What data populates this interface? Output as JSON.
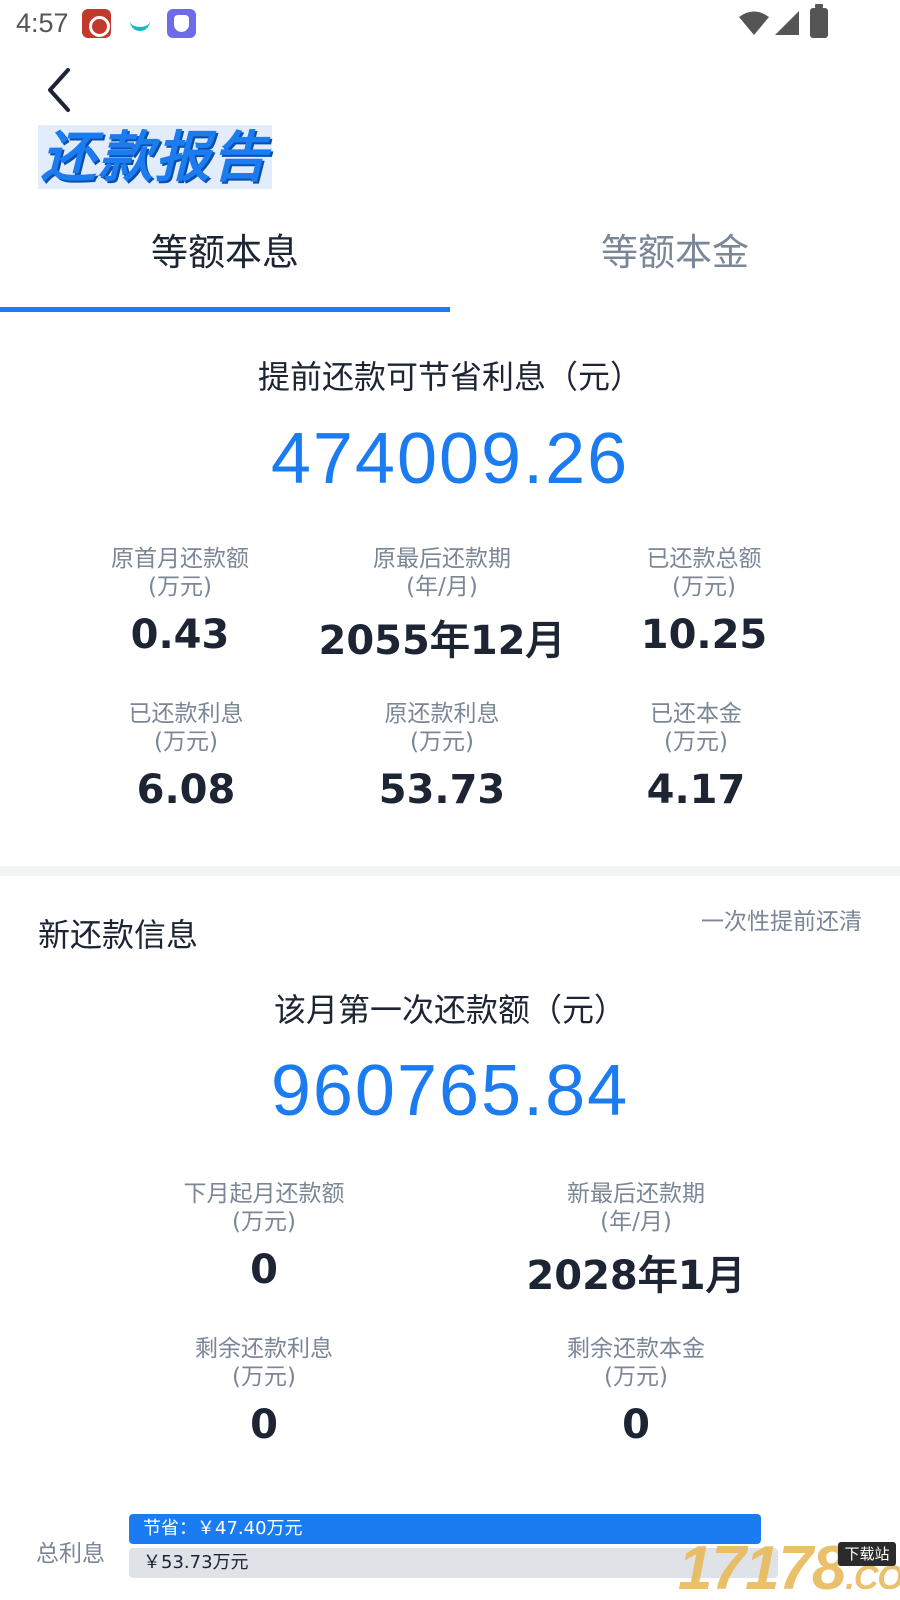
{
  "status": {
    "time": "4:57",
    "icons": [
      "weibo-app-icon",
      "teal-app-icon",
      "purple-app-icon",
      "wifi-icon",
      "signal-icon",
      "battery-icon"
    ]
  },
  "header": {
    "back_icon": "chevron-left-icon",
    "title": "还款报告"
  },
  "tabs": [
    {
      "label": "等额本息",
      "active": true
    },
    {
      "label": "等额本金",
      "active": false
    }
  ],
  "savings": {
    "title": "提前还款可节省利息（元）",
    "value": "474009.26"
  },
  "original_stats": [
    {
      "label": "原首月还款额",
      "unit": "(万元)",
      "value": "0.43"
    },
    {
      "label": "原最后还款期",
      "unit": "(年/月)",
      "value": "2055年12月"
    },
    {
      "label": "已还款总额",
      "unit": "(万元)",
      "value": "10.25"
    },
    {
      "label": "已还款利息",
      "unit": "(万元)",
      "value": "6.08"
    },
    {
      "label": "原还款利息",
      "unit": "(万元)",
      "value": "53.73"
    },
    {
      "label": "已还本金",
      "unit": "(万元)",
      "value": "4.17"
    }
  ],
  "new_info": {
    "section_title": "新还款信息",
    "mode_link": "一次性提前还清",
    "first_payment_title": "该月第一次还款额（元）",
    "first_payment_value": "960765.84",
    "stats": [
      {
        "label": "下月起月还款额",
        "unit": "(万元)",
        "value": "0"
      },
      {
        "label": "新最后还款期",
        "unit": "(年/月)",
        "value": "2028年1月"
      },
      {
        "label": "剩余还款利息",
        "unit": "(万元)",
        "value": "0"
      },
      {
        "label": "剩余还款本金",
        "unit": "(万元)",
        "value": "0"
      }
    ]
  },
  "interest_bar": {
    "label": "总利息",
    "saved_text": "节省：￥47.40万元",
    "total_text": "￥53.73万元",
    "saved_fraction": 0.882
  },
  "watermark": {
    "text": "17178",
    "suffix": ".COM",
    "badge": "下载站"
  },
  "colors": {
    "accent": "#1b7cf2",
    "text": "#1d2433",
    "muted": "#7b8696"
  }
}
